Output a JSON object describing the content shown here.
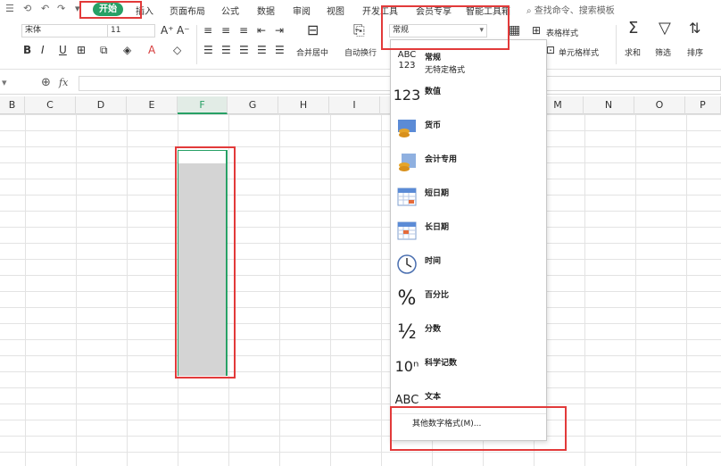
{
  "menubar": {
    "quick_access": [
      "☰",
      "⟲",
      "↶",
      "↷",
      "▾"
    ],
    "tabs": [
      "开始",
      "插入",
      "页面布局",
      "公式",
      "数据",
      "审阅",
      "视图",
      "开发工具",
      "会员专享",
      "智能工具箱"
    ],
    "search_placeholder": "查找命令、搜索模板"
  },
  "ribbon": {
    "font_name": "宋体",
    "font_size": "11",
    "merge_label": "合并居中",
    "wrap_label": "自动换行",
    "number_format_value": "常规",
    "table_style_label": "表格样式",
    "cell_style_label": "单元格样式",
    "sum_label": "求和",
    "filter_label": "筛选",
    "sort_label": "排序",
    "bold": "B",
    "italic": "I",
    "underline": "U"
  },
  "formula_bar": {
    "fx": "fx"
  },
  "columns": [
    "B",
    "C",
    "D",
    "E",
    "F",
    "G",
    "H",
    "I",
    "M",
    "N",
    "O",
    "P"
  ],
  "active_column": "F",
  "dropdown": {
    "items": [
      {
        "label": "常规",
        "sub": "无特定格式",
        "icon": "abc-123-icon",
        "glyph": "ABC 123"
      },
      {
        "label": "数值",
        "sub": "",
        "icon": "number-icon",
        "glyph": "123"
      },
      {
        "label": "货币",
        "sub": "",
        "icon": "currency-icon",
        "glyph": "¤"
      },
      {
        "label": "会计专用",
        "sub": "",
        "icon": "accounting-icon",
        "glyph": "¤"
      },
      {
        "label": "短日期",
        "sub": "",
        "icon": "calendar-icon",
        "glyph": "▦"
      },
      {
        "label": "长日期",
        "sub": "",
        "icon": "calendar-long-icon",
        "glyph": "▦"
      },
      {
        "label": "时间",
        "sub": "",
        "icon": "clock-icon",
        "glyph": "◷"
      },
      {
        "label": "百分比",
        "sub": "",
        "icon": "percent-icon",
        "glyph": "%"
      },
      {
        "label": "分数",
        "sub": "",
        "icon": "fraction-icon",
        "glyph": "½"
      },
      {
        "label": "科学记数",
        "sub": "",
        "icon": "scientific-icon",
        "glyph": "10ⁿ"
      },
      {
        "label": "文本",
        "sub": "",
        "icon": "text-abc-icon",
        "glyph": "ABC"
      }
    ],
    "more_label": "其他数字格式(M)..."
  },
  "colors": {
    "accent": "#27a065",
    "highlight": "#e23a3a",
    "selection": "#d4d4d4"
  }
}
